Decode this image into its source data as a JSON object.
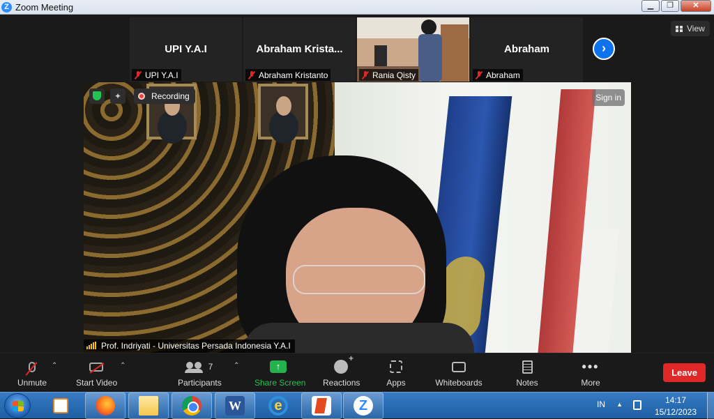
{
  "window": {
    "title": "Zoom Meeting",
    "minimize": "▁",
    "restore": "❐",
    "close": "✕"
  },
  "view_button": {
    "label": "View"
  },
  "participants_strip": [
    {
      "big_name": "UPI Y.A.I",
      "name": "UPI Y.A.I",
      "video": false
    },
    {
      "big_name": "Abraham  Krista...",
      "name": "Abraham Kristanto",
      "video": false
    },
    {
      "big_name": "",
      "name": "Rania Qisty",
      "video": true
    },
    {
      "big_name": "Abraham",
      "name": "Abraham",
      "video": false
    }
  ],
  "next_button": {
    "label": "›"
  },
  "speaker": {
    "name": "Prof. Indriyati - Universitas Persada Indonesia Y.A.I",
    "recording_label": "Recording",
    "sign_in_label": "Sign in",
    "spark_glyph": "✦"
  },
  "toolbar": {
    "unmute": "Unmute",
    "start_video": "Start Video",
    "participants": "Participants",
    "participants_count": "7",
    "share_screen": "Share Screen",
    "share_glyph": "↑",
    "reactions": "Reactions",
    "apps": "Apps",
    "whiteboards": "Whiteboards",
    "notes": "Notes",
    "more": "More",
    "more_glyph": "•••",
    "leave": "Leave",
    "caret": "⌃"
  },
  "taskbar": {
    "apps": [
      "windows-media-player",
      "firefox",
      "file-explorer",
      "chrome",
      "microsoft-word",
      "internet-explorer",
      "microsoft-office",
      "zoom"
    ],
    "word_glyph": "W",
    "ie_glyph": "e",
    "zoom_glyph": "Z",
    "language": "IN",
    "tray_arrow": "▲",
    "time": "14:17",
    "date": "15/12/2023"
  },
  "colors": {
    "leave": "#e02828",
    "share": "#23b24b",
    "zoom_blue": "#0e72ed",
    "recording_dot": "#e8473a",
    "shield": "#23c552"
  }
}
